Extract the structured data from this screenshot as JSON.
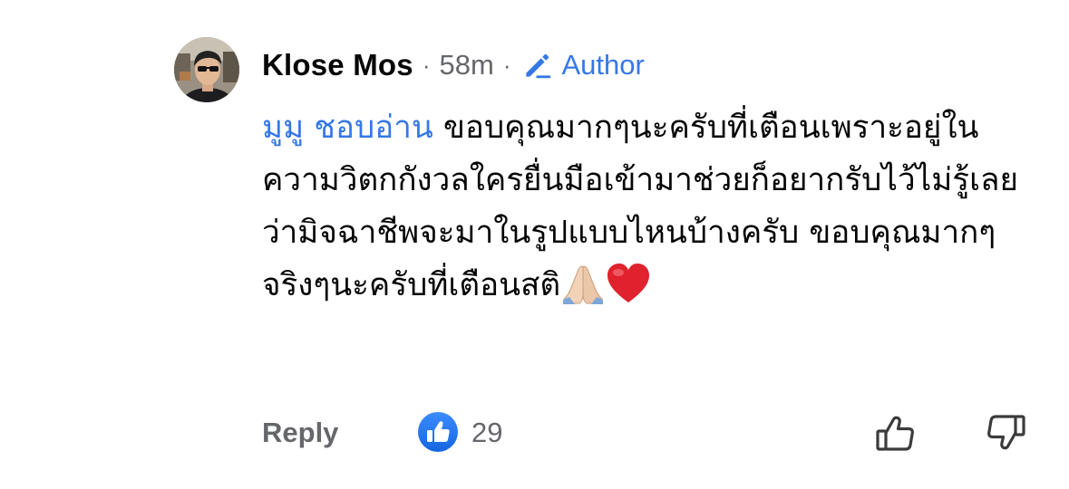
{
  "comment": {
    "author": "Klose Mos",
    "separator": "·",
    "time": "58m",
    "badge_label": "Author",
    "mention": "มูมู ชอบอ่าน",
    "text": " ขอบคุณมากๆนะครับที่เตือนเพราะอยู่ในความวิตกกังวลใครยื่นมือเข้ามาช่วยก็อยากรับไว้ไม่รู้เลยว่ามิจฉาชีพจะมาในรูปแบบไหนบ้างครับ ขอบคุณมากๆจริงๆนะครับที่เตือนสติ",
    "emojis": [
      "folded-hands-icon",
      "red-heart-icon"
    ]
  },
  "actions": {
    "reply_label": "Reply",
    "like_count": "29"
  },
  "colors": {
    "accent_blue": "#3578e5",
    "muted_gray": "#65676b",
    "text": "#050505"
  }
}
